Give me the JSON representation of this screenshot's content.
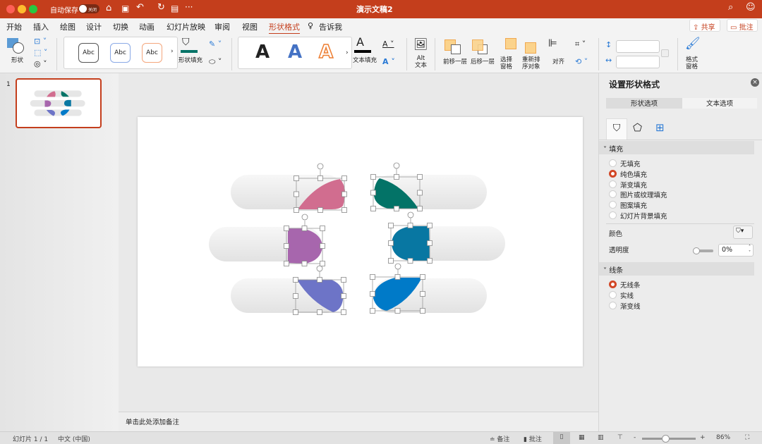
{
  "titlebar": {
    "autosave": "自动保存",
    "autosave_state": "关闭",
    "doc_title": "演示文稿2"
  },
  "tabs": [
    "开始",
    "插入",
    "绘图",
    "设计",
    "切换",
    "动画",
    "幻灯片放映",
    "审阅",
    "视图",
    "形状格式",
    "告诉我"
  ],
  "active_tab": "形状格式",
  "share": "共享",
  "comments": "批注",
  "ribbon": {
    "shapes": "形状",
    "style_sample": "Abc",
    "shape_fill": "形状填充",
    "wordart_sample": "A",
    "text_fill": "文本填充",
    "alt_text": [
      "Alt",
      "文本"
    ],
    "bring_forward": "前移一层",
    "send_backward": "后移一层",
    "selection_pane": [
      "选择",
      "窗格"
    ],
    "reorder": [
      "重新排",
      "序对象"
    ],
    "align": "对齐",
    "format_pane": [
      "格式",
      "窗格"
    ]
  },
  "thumbnail_number": "1",
  "notes_placeholder": "单击此处添加备注",
  "pane": {
    "title": "设置形状格式",
    "tab_shape": "形状选项",
    "tab_text": "文本选项",
    "fill_header": "填充",
    "fill_options": [
      "无填充",
      "纯色填充",
      "渐变填充",
      "图片或纹理填充",
      "图案填充",
      "幻灯片背景填充"
    ],
    "fill_selected": 1,
    "color_label": "颜色",
    "transparency_label": "透明度",
    "transparency_value": "0%",
    "line_header": "线条",
    "line_options": [
      "无线条",
      "实线",
      "渐变线"
    ],
    "line_selected": 0
  },
  "status": {
    "slide": "幻灯片 1 / 1",
    "language": "中文 (中国)",
    "notes": "备注",
    "comments": "批注",
    "zoom": "86%",
    "zoom_fraction": 0.43
  },
  "colors": {
    "accent": "#c43e1c",
    "pink": "#d16d8f",
    "teal": "#037367",
    "purple": "#a766ad",
    "teal_blue": "#0877a2",
    "violet": "#6d74c7",
    "blue": "#007ac8"
  }
}
